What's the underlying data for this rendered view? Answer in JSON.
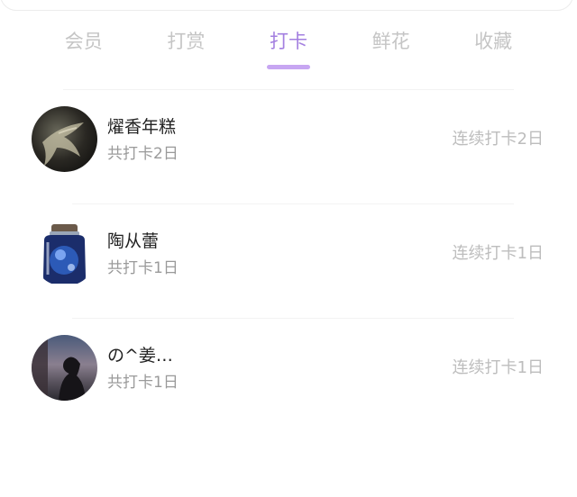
{
  "tabs": [
    {
      "label": "会员",
      "active": false
    },
    {
      "label": "打赏",
      "active": false
    },
    {
      "label": "打卡",
      "active": true
    },
    {
      "label": "鲜花",
      "active": false
    },
    {
      "label": "收藏",
      "active": false
    }
  ],
  "accent_color": "#a37fe0",
  "members": [
    {
      "name": "燿香年糕",
      "total": "共打卡2日",
      "streak": "连续打卡2日",
      "avatar_icon": "dark-photo-avatar"
    },
    {
      "name": "陶从蕾",
      "total": "共打卡1日",
      "streak": "连续打卡1日",
      "avatar_icon": "glass-jar-avatar"
    },
    {
      "name": "の^姜…",
      "total": "共打卡1日",
      "streak": "连续打卡1日",
      "avatar_icon": "silhouette-avatar"
    }
  ]
}
